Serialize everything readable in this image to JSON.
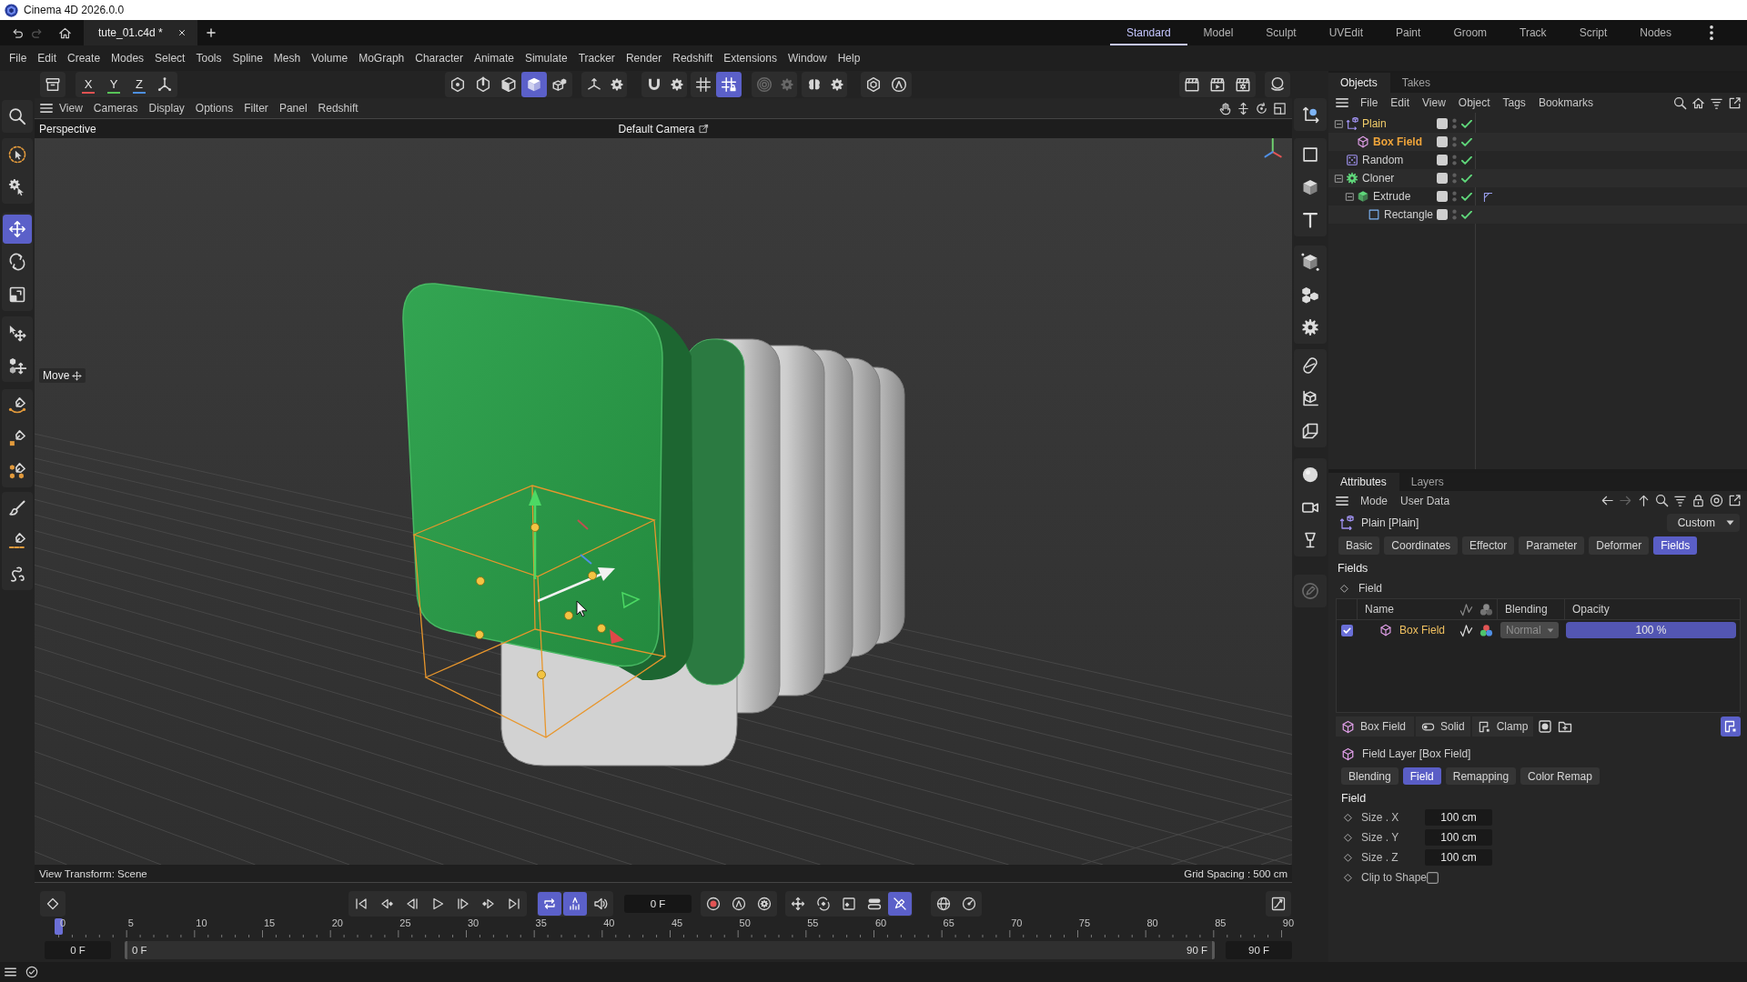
{
  "window": {
    "title": "Cinema 4D 2026.0.0"
  },
  "history_buttons": [
    {
      "disabled": false
    },
    {
      "disabled": true
    },
    {
      "disabled": false
    }
  ],
  "document_tabs": [
    {
      "label": "tute_01.c4d *",
      "selected": true
    }
  ],
  "layouts": [
    {
      "label": "Standard",
      "selected": true
    },
    {
      "label": "Model",
      "selected": false
    },
    {
      "label": "Sculpt",
      "selected": false
    },
    {
      "label": "UVEdit",
      "selected": false
    },
    {
      "label": "Paint",
      "selected": false
    },
    {
      "label": "Groom",
      "selected": false
    },
    {
      "label": "Track",
      "selected": false
    },
    {
      "label": "Script",
      "selected": false
    },
    {
      "label": "Nodes",
      "selected": false
    }
  ],
  "menu_bar": [
    "File",
    "Edit",
    "Create",
    "Modes",
    "Select",
    "Tools",
    "Spline",
    "Mesh",
    "Volume",
    "MoGraph",
    "Character",
    "Animate",
    "Simulate",
    "Tracker",
    "Render",
    "Redshift",
    "Extensions",
    "Window",
    "Help"
  ],
  "toolbar": {
    "axis_locks": [
      {
        "label": "X",
        "color": "#e05252"
      },
      {
        "label": "Y",
        "color": "#58c458"
      },
      {
        "label": "Z",
        "color": "#4d8fe0"
      }
    ],
    "buttons": [
      {
        "selected": false,
        "disabled": false
      },
      {
        "selected": false,
        "disabled": false
      },
      {
        "selected": false,
        "disabled": false
      },
      {
        "selected": false,
        "disabled": false
      },
      {
        "selected": false,
        "disabled": false
      },
      {
        "selected": true,
        "disabled": false
      },
      {
        "selected": false,
        "disabled": false
      },
      {
        "selected": false,
        "disabled": false
      },
      {
        "selected": false,
        "disabled": false
      },
      {
        "selected": false,
        "disabled": false
      },
      {
        "selected": false,
        "disabled": false
      },
      {
        "selected": false,
        "disabled": false
      },
      {
        "selected": true,
        "disabled": false
      },
      {
        "selected": false,
        "disabled": true
      },
      {
        "selected": false,
        "disabled": true
      },
      {
        "selected": false,
        "disabled": false
      },
      {
        "selected": false,
        "disabled": false
      },
      {
        "selected": false,
        "disabled": false
      },
      {
        "selected": false,
        "disabled": false
      },
      {
        "selected": false,
        "disabled": false
      },
      {
        "selected": false,
        "disabled": false
      },
      {
        "selected": false,
        "disabled": false
      },
      {
        "selected": false,
        "disabled": false
      }
    ]
  },
  "left_tools": [
    {
      "selected": false
    },
    {
      "selected": false
    },
    {
      "selected": false
    },
    {
      "selected": true
    },
    {
      "selected": false
    },
    {
      "selected": false
    },
    {
      "selected": false
    },
    {
      "selected": false
    },
    {
      "selected": false
    },
    {
      "selected": false
    },
    {
      "selected": false
    },
    {
      "selected": false
    },
    {
      "selected": false
    },
    {
      "selected": false
    }
  ],
  "viewport": {
    "menu": [
      "View",
      "Cameras",
      "Display",
      "Options",
      "Filter",
      "Panel",
      "Redshift"
    ],
    "projection": "Perspective",
    "camera": "Default Camera",
    "tool_hud": "Move",
    "view_transform": "View Transform: Scene",
    "grid_spacing": "Grid Spacing : 500 cm"
  },
  "object_tools": [
    {
      "disabled": false
    },
    {
      "disabled": false
    },
    {
      "disabled": false
    },
    {
      "disabled": false
    },
    {
      "disabled": false
    },
    {
      "disabled": false
    },
    {
      "disabled": false
    },
    {
      "disabled": false
    },
    {
      "disabled": false
    },
    {
      "disabled": false
    },
    {
      "disabled": false
    },
    {
      "disabled": false
    },
    {
      "disabled": false
    },
    {
      "disabled": true
    }
  ],
  "timeline": {
    "buttons": [
      {
        "selected": false
      },
      {
        "selected": false
      },
      {
        "selected": false
      },
      {
        "selected": false
      },
      {
        "selected": false
      },
      {
        "selected": false
      },
      {
        "selected": false
      },
      {
        "selected": false
      },
      {
        "selected": true
      },
      {
        "selected": true
      },
      {
        "selected": false
      },
      {
        "selected": false
      },
      {
        "selected": false
      },
      {
        "selected": false
      },
      {
        "selected": false
      },
      {
        "selected": false
      },
      {
        "selected": false
      },
      {
        "selected": false
      },
      {
        "selected": true
      },
      {
        "selected": false
      },
      {
        "selected": false
      },
      {
        "selected": false
      }
    ],
    "current_frame": "0 F",
    "ruler": [
      "0",
      "5",
      "10",
      "15",
      "20",
      "25",
      "30",
      "35",
      "40",
      "45",
      "50",
      "55",
      "60",
      "65",
      "70",
      "75",
      "80",
      "85",
      "90"
    ],
    "playhead": {
      "level": 0
    },
    "range_start": "0 F",
    "range_bar": {
      "start": "0 F",
      "end": "90 F",
      "level": 1
    },
    "range_end": "90 F"
  },
  "objects_panel": {
    "tabs": [
      {
        "label": "Objects",
        "selected": true
      },
      {
        "label": "Takes",
        "selected": false
      }
    ],
    "menu": [
      "File",
      "Edit",
      "View",
      "Object",
      "Tags",
      "Bookmarks"
    ],
    "tree": [
      {
        "name": "Plain",
        "kind": "plain",
        "selected": true,
        "active": false,
        "enabled": true,
        "tagged": false,
        "expanded": true,
        "children": [
          {
            "name": "Box Field",
            "kind": "boxfield",
            "selected": true,
            "active": true,
            "enabled": true,
            "tagged": false
          }
        ]
      },
      {
        "name": "Random",
        "kind": "random",
        "selected": false,
        "active": false,
        "enabled": true,
        "tagged": false
      },
      {
        "name": "Cloner",
        "kind": "cloner",
        "selected": false,
        "active": false,
        "enabled": true,
        "tagged": false,
        "expanded": true,
        "children": [
          {
            "name": "Extrude",
            "kind": "extrude",
            "selected": false,
            "active": false,
            "enabled": true,
            "tagged": true,
            "expanded": true,
            "children": [
              {
                "name": "Rectangle",
                "kind": "rectangle",
                "selected": false,
                "active": false,
                "enabled": true,
                "tagged": false
              }
            ]
          }
        ]
      }
    ]
  },
  "attributes_panel": {
    "tabs": [
      {
        "label": "Attributes",
        "selected": true
      },
      {
        "label": "Layers",
        "selected": false
      }
    ],
    "menu": [
      "Mode",
      "User Data"
    ],
    "nav_buttons": [
      {
        "disabled": false
      },
      {
        "disabled": true
      },
      {
        "disabled": false
      },
      {
        "disabled": false
      },
      {
        "disabled": false
      },
      {
        "disabled": false
      },
      {
        "disabled": false
      },
      {
        "disabled": false
      }
    ],
    "object": "Plain [Plain]",
    "preset": "Custom",
    "pages": [
      {
        "label": "Basic",
        "selected": false
      },
      {
        "label": "Coordinates",
        "selected": false
      },
      {
        "label": "Effector",
        "selected": false
      },
      {
        "label": "Parameter",
        "selected": false
      },
      {
        "label": "Deformer",
        "selected": false
      },
      {
        "label": "Fields",
        "selected": true
      }
    ],
    "section": "Fields",
    "field_param": "Field",
    "field_list": {
      "columns": [
        "Name",
        "Blending",
        "Opacity"
      ],
      "rows": [
        {
          "name": "Box Field",
          "checked": true,
          "blending": "Normal",
          "blending_disabled": true,
          "opacity": "100 %",
          "level": 1
        }
      ]
    },
    "layer_toolbar": [
      "Box Field",
      "Solid",
      "Clamp"
    ],
    "layer_buttons": [
      {
        "selected": false
      },
      {
        "selected": false
      },
      {
        "selected": true
      }
    ],
    "layer_title": "Field Layer [Box Field]",
    "layer_tabs": [
      {
        "label": "Blending",
        "selected": false
      },
      {
        "label": "Field",
        "selected": true
      },
      {
        "label": "Remapping",
        "selected": false
      },
      {
        "label": "Color Remap",
        "selected": false
      }
    ],
    "layer_section": "Field",
    "params": [
      {
        "kind": "number",
        "label": "Size . X",
        "value": "100 cm"
      },
      {
        "kind": "number",
        "label": "Size . Y",
        "value": "100 cm"
      },
      {
        "kind": "number",
        "label": "Size . Z",
        "value": "100 cm"
      },
      {
        "kind": "checkbox",
        "label": "Clip to Shape",
        "checked": false
      }
    ]
  }
}
